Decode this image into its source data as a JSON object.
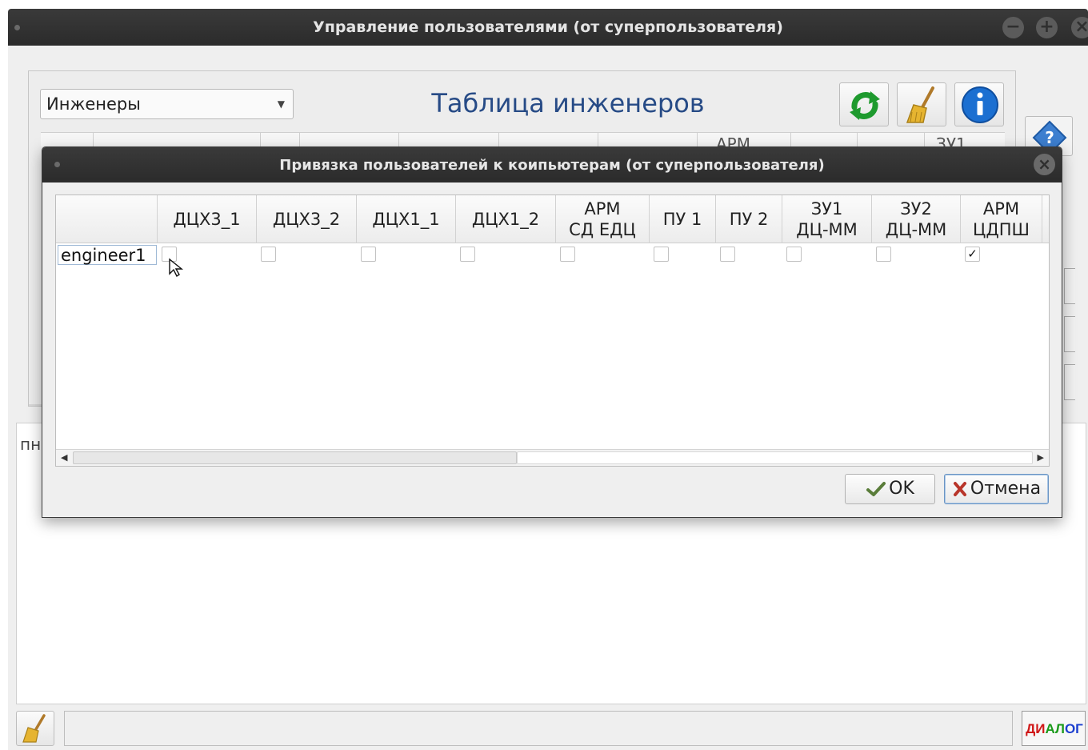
{
  "main_window": {
    "title": "Управление пользователями (от суперпользователя)",
    "role_select": {
      "value": "Инженеры"
    },
    "table_title": "Таблица инженеров",
    "background_table_partial_headers": [
      "АРМ",
      "ЗУ1"
    ],
    "log_prefix_partial": "пн",
    "status_indicator": {
      "label": "ДИАЛОГ",
      "colors": [
        "#d01818",
        "#1a9a1a",
        "#1c3fcf"
      ]
    }
  },
  "toolbar_icons": [
    "refresh-icon",
    "broom-icon",
    "info-icon",
    "help-icon"
  ],
  "dialog": {
    "title": "Привязка пользователей к коипьютерам (от суперпользователя)",
    "columns": [
      "ДЦХ3_1",
      "ДЦХ3_2",
      "ДЦХ1_1",
      "ДЦХ1_2",
      "АРМ\nСД ЕДЦ",
      "ПУ 1",
      "ПУ 2",
      "ЗУ1\nДЦ-ММ",
      "ЗУ2\nДЦ-ММ",
      "АРМ\nЦДПШ"
    ],
    "rows": [
      {
        "user": "engineer1",
        "checks": [
          false,
          false,
          false,
          false,
          false,
          false,
          false,
          false,
          false,
          true
        ]
      }
    ],
    "ok_label": "OK",
    "cancel_label": "Отмена"
  },
  "colors": {
    "titlebar": "#2f2f2f",
    "accent_blue": "#274b86",
    "refresh_green": "#1e9a2e",
    "info_blue": "#1b6fd1"
  }
}
